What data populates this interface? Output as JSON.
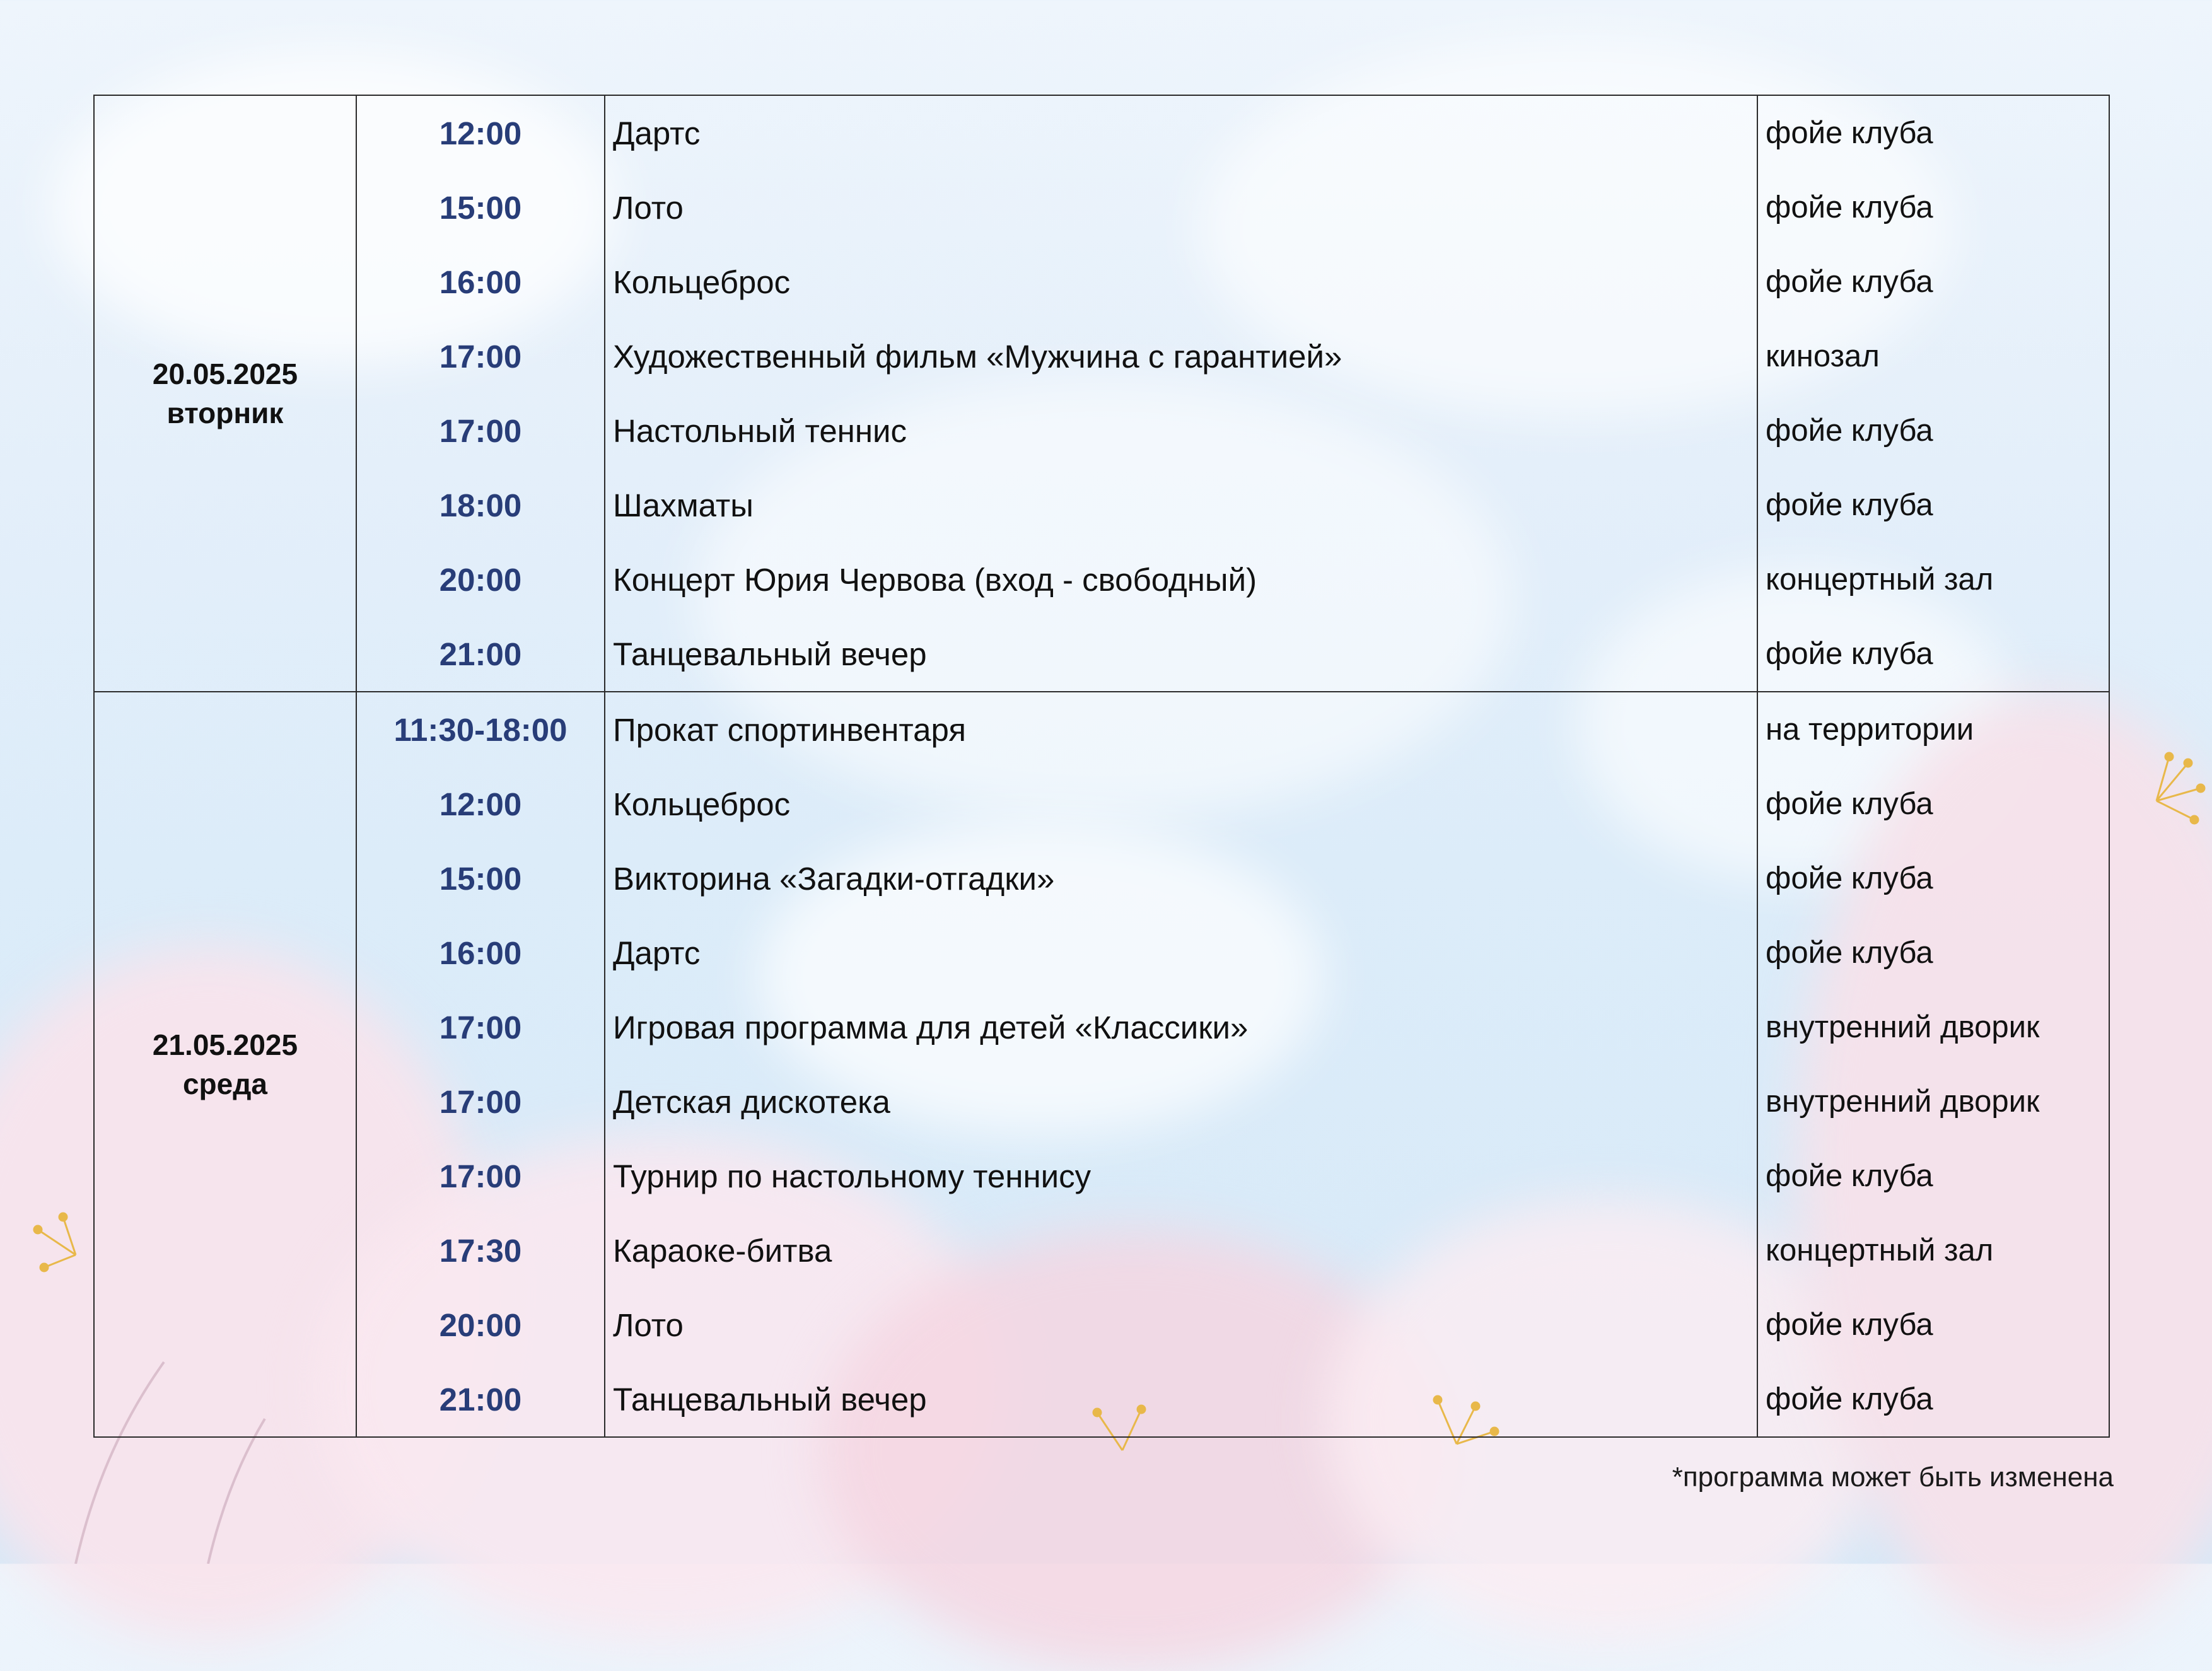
{
  "days": [
    {
      "date": "20.05.2025",
      "weekday": "вторник",
      "events": [
        {
          "time": "12:00",
          "title": "Дартс",
          "place": "фойе клуба"
        },
        {
          "time": "15:00",
          "title": "Лото",
          "place": "фойе клуба"
        },
        {
          "time": "16:00",
          "title": "Кольцеброс",
          "place": "фойе клуба"
        },
        {
          "time": "17:00",
          "title": "Художественный фильм «Мужчина с гарантией»",
          "place": "кинозал"
        },
        {
          "time": "17:00",
          "title": "Настольный теннис",
          "place": "фойе клуба"
        },
        {
          "time": "18:00",
          "title": "Шахматы",
          "place": "фойе клуба"
        },
        {
          "time": "20:00",
          "title": "Концерт Юрия Червова (вход - свободный)",
          "place": "концертный зал"
        },
        {
          "time": "21:00",
          "title": "Танцевальный вечер",
          "place": "фойе клуба"
        }
      ]
    },
    {
      "date": "21.05.2025",
      "weekday": "среда",
      "events": [
        {
          "time": "11:30-18:00",
          "title": "Прокат спортинвентаря",
          "place": "на территории"
        },
        {
          "time": "12:00",
          "title": "Кольцеброс",
          "place": "фойе клуба"
        },
        {
          "time": "15:00",
          "title": "Викторина «Загадки-отгадки»",
          "place": "фойе клуба"
        },
        {
          "time": "16:00",
          "title": "Дартс",
          "place": "фойе клуба"
        },
        {
          "time": "17:00",
          "title": "Игровая программа для детей «Классики»",
          "place": "внутренний дворик"
        },
        {
          "time": "17:00",
          "title": "Детская дискотека",
          "place": "внутренний дворик"
        },
        {
          "time": "17:00",
          "title": "Турнир по настольному теннису",
          "place": "фойе клуба"
        },
        {
          "time": "17:30",
          "title": "Караоке-битва",
          "place": "концертный зал"
        },
        {
          "time": "20:00",
          "title": "Лото",
          "place": "фойе клуба"
        },
        {
          "time": "21:00",
          "title": "Танцевальный вечер",
          "place": "фойе клуба"
        }
      ]
    }
  ],
  "footnote": "*программа может быть изменена",
  "colors": {
    "time_text": "#283d78",
    "border": "#2b2b2b",
    "background": "#e4effa",
    "blossom": "#f6dce6"
  }
}
